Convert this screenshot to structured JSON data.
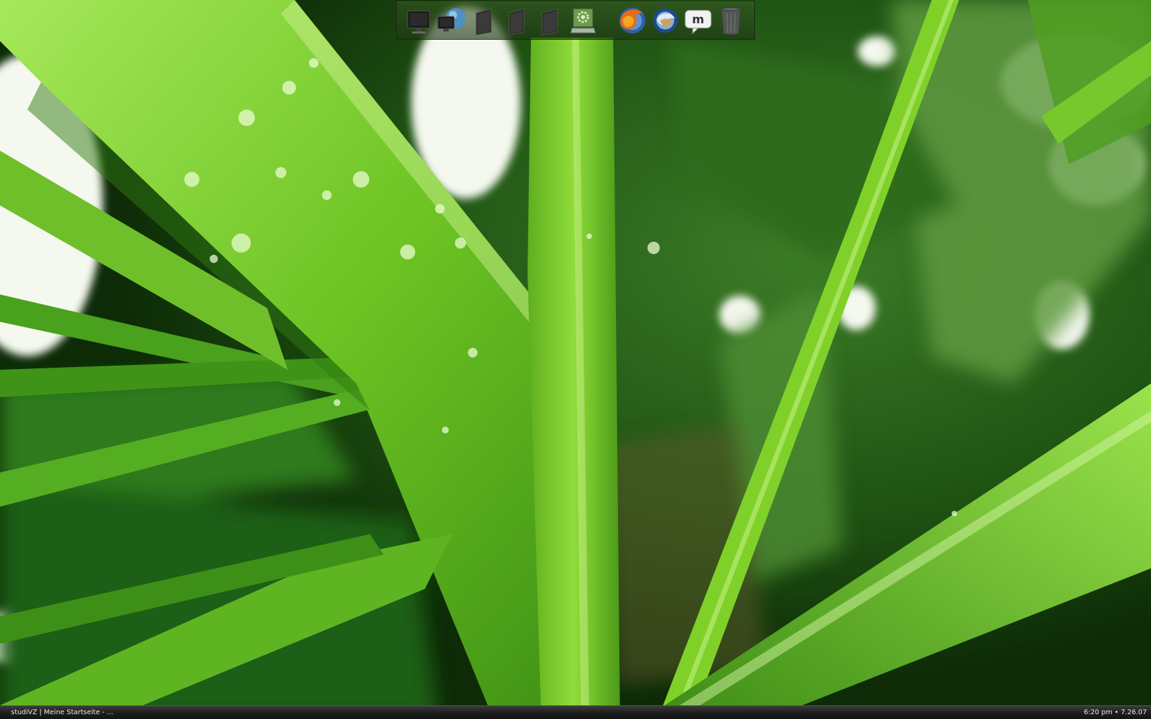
{
  "dock": {
    "items": [
      {
        "name": "display-monitor-icon",
        "kind": "monitor"
      },
      {
        "name": "network-globe-icon",
        "kind": "network"
      },
      {
        "name": "folder-drawer-icon",
        "kind": "drawer"
      },
      {
        "name": "folder-drawer-icon",
        "kind": "drawer"
      },
      {
        "name": "folder-drawer-icon",
        "kind": "drawer"
      },
      {
        "name": "system-preferences-icon",
        "kind": "prefs"
      },
      {
        "name": "firefox-icon",
        "kind": "firefox"
      },
      {
        "name": "thunderbird-icon",
        "kind": "thunderbird"
      },
      {
        "name": "messenger-icon",
        "kind": "messenger"
      },
      {
        "name": "trash-icon",
        "kind": "trash"
      }
    ]
  },
  "taskbar": {
    "task_label": "studiVZ | Meine Startseite - ...",
    "clock_text": "6:20 pm • 7.26.07"
  },
  "colors": {
    "leaf_bright": "#7fd12a",
    "leaf_mid": "#4fa51c",
    "leaf_dark": "#1f5a10",
    "taskbar_bg": "#1c1c1c"
  }
}
